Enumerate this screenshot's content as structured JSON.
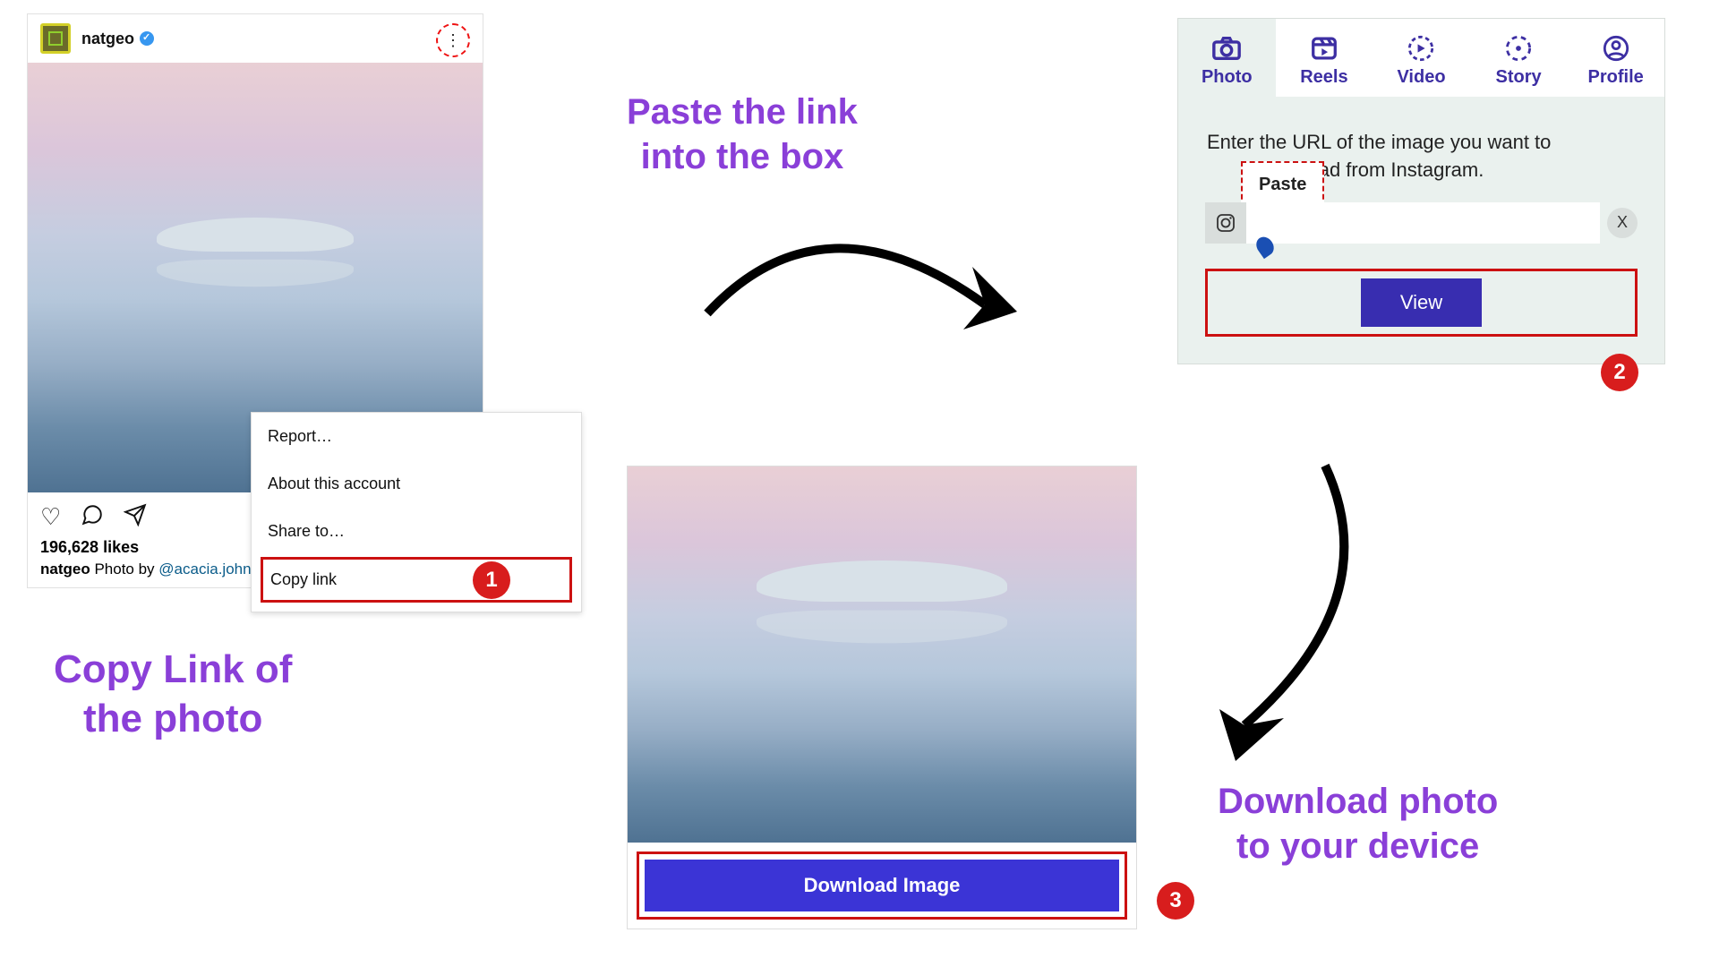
{
  "captions": {
    "step1": "Copy Link of\nthe photo",
    "step2": "Paste the link\ninto the box",
    "step3": "Download photo\nto your device"
  },
  "badges": {
    "one": "1",
    "two": "2",
    "three": "3"
  },
  "instagram": {
    "username": "natgeo",
    "more_glyph": "⋮",
    "actions": {
      "like": "♡",
      "comment": "💬",
      "share": "➤"
    },
    "likes": "196,628 likes",
    "caption_user": "natgeo",
    "caption_prefix": " Photo by ",
    "caption_link": "@acacia.john",
    "menu": {
      "report": "Report…",
      "about": "About this account",
      "share_to": "Share to…",
      "copy_link": "Copy link"
    }
  },
  "downloader": {
    "tabs": {
      "photo": "Photo",
      "reels": "Reels",
      "video": "Video",
      "story": "Story",
      "profile": "Profile"
    },
    "prompt_line1": "Enter the URL of the image you want to",
    "prompt_line2_suffix": "load from Instagram.",
    "paste_tip": "Paste",
    "clear": "X",
    "view": "View"
  },
  "result": {
    "download": "Download Image"
  }
}
